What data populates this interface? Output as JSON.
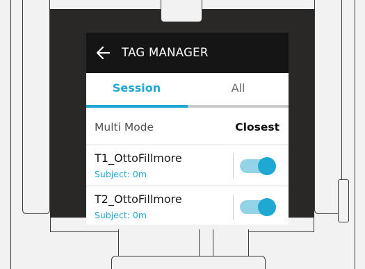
{
  "header": {
    "title": "TAG MANAGER",
    "back_icon": "arrow-left-icon"
  },
  "tabs": [
    {
      "label": "Session",
      "active": true
    },
    {
      "label": "All",
      "active": false
    }
  ],
  "multi_mode": {
    "label": "Multi Mode",
    "value": "Closest"
  },
  "tags": [
    {
      "name": "T1_OttoFillmore",
      "subject": "Subject: 0m",
      "enabled": true
    },
    {
      "name": "T2_OttoFillmore",
      "subject": "Subject: 0m",
      "enabled": true
    }
  ],
  "colors": {
    "accent": "#1fa8d2",
    "toggle_track": "#93d3e8",
    "titlebar": "#151515",
    "bezel": "#2a2727"
  }
}
